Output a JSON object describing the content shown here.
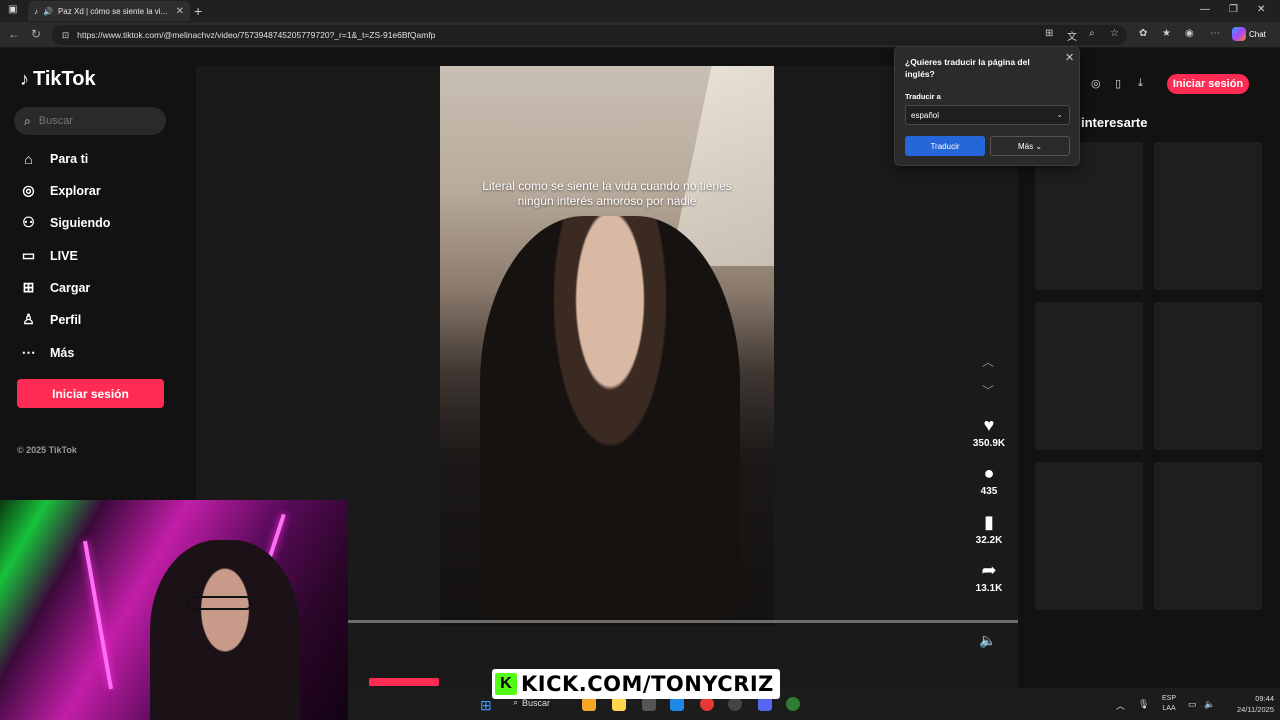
{
  "browser": {
    "tab_title": "Paz Xd | cómo se siente la vi...",
    "url": "https://www.tiktok.com/@melinachvz/video/7573948745205779720?_r=1&_t=ZS-91e6BfQamfp",
    "chat_label": "Chat"
  },
  "tiktok": {
    "brand": "TikTok",
    "search_placeholder": "Buscar",
    "nav": [
      {
        "label": "Para ti",
        "icon": "home-icon"
      },
      {
        "label": "Explorar",
        "icon": "compass-icon"
      },
      {
        "label": "Siguiendo",
        "icon": "following-icon"
      },
      {
        "label": "LIVE",
        "icon": "live-icon"
      },
      {
        "label": "Cargar",
        "icon": "upload-icon"
      },
      {
        "label": "Perfil",
        "icon": "profile-icon"
      },
      {
        "label": "Más",
        "icon": "more-icon"
      }
    ],
    "login_label": "Iniciar sesión",
    "copyright": "© 2025 TikTok"
  },
  "video": {
    "caption": "Literal como se siente la vida cuando no tienes ningún interés amoroso por nadie",
    "likes": "350.9K",
    "comments": "435",
    "saves": "32.2K",
    "shares": "13.1K"
  },
  "right_panel": {
    "login_label": "Iniciar sesión",
    "title": "interesarte"
  },
  "translate_popup": {
    "title": "¿Quieres traducir la página del inglés?",
    "translate_to_label": "Traducir a",
    "language": "español",
    "translate_button": "Traducir",
    "more_button": "Más"
  },
  "overlay": {
    "kick_text": "KICK.COM/TONYCRIZ"
  },
  "taskbar": {
    "search_label": "Buscar",
    "lang_line1": "ESP",
    "lang_line2": "LAA",
    "time": "09:44",
    "date": "24/11/2025"
  },
  "colors": {
    "accent": "#fe2c55",
    "translate_blue": "#2567d8",
    "kick_green": "#53fc18"
  }
}
